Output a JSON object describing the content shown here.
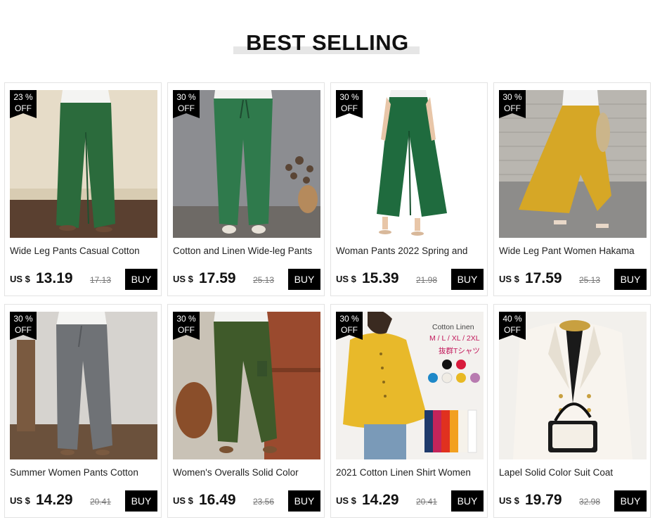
{
  "section": {
    "title": "BEST SELLING"
  },
  "products": [
    {
      "name": "Wide Leg Pants Casual Cotton",
      "discount_pct": "23 %",
      "discount_label": "OFF",
      "currency": "US $",
      "price": "13.19",
      "old_price": "17.13",
      "buy_label": "BUY",
      "image": "green-wide-leg-pants-photo"
    },
    {
      "name": "Cotton and Linen Wide-leg Pants",
      "discount_pct": "30 %",
      "discount_label": "OFF",
      "currency": "US $",
      "price": "17.59",
      "old_price": "25.13",
      "buy_label": "BUY",
      "image": "green-linen-pants-photo"
    },
    {
      "name": "Woman Pants 2022 Spring and",
      "discount_pct": "30 %",
      "discount_label": "OFF",
      "currency": "US $",
      "price": "15.39",
      "old_price": "21.98",
      "buy_label": "BUY",
      "image": "green-flare-pants-photo"
    },
    {
      "name": "Wide Leg Pant Women Hakama",
      "discount_pct": "30 %",
      "discount_label": "OFF",
      "currency": "US $",
      "price": "17.59",
      "old_price": "25.13",
      "buy_label": "BUY",
      "image": "mustard-hakama-pants-photo"
    },
    {
      "name": "Summer Women Pants Cotton",
      "discount_pct": "30 %",
      "discount_label": "OFF",
      "currency": "US $",
      "price": "14.29",
      "old_price": "20.41",
      "buy_label": "BUY",
      "image": "grey-wide-pants-photo"
    },
    {
      "name": "Women's Overalls Solid Color",
      "discount_pct": "30 %",
      "discount_label": "OFF",
      "currency": "US $",
      "price": "16.49",
      "old_price": "23.56",
      "buy_label": "BUY",
      "image": "army-green-cargo-pants-photo"
    },
    {
      "name": "2021 Cotton Linen Shirt Women",
      "discount_pct": "30 %",
      "discount_label": "OFF",
      "currency": "US $",
      "price": "14.29",
      "old_price": "20.41",
      "buy_label": "BUY",
      "image": "yellow-linen-shirt-photo",
      "ad_text": {
        "line1": "Cotton Linen",
        "line2": "M / L / XL / 2XL",
        "line3": "抜群Tシャツ"
      },
      "swatches": [
        "#111111",
        "#d81b3c",
        "#1e88c8",
        "#f0ece4",
        "#e8b923",
        "#b87bb0"
      ]
    },
    {
      "name": "Lapel Solid Color Suit Coat",
      "discount_pct": "40 %",
      "discount_label": "OFF",
      "currency": "US $",
      "price": "19.79",
      "old_price": "32.98",
      "buy_label": "BUY",
      "image": "white-blazer-photo"
    }
  ],
  "colors": {
    "buy_button": "#000000",
    "badge": "#000000",
    "header_underline": "#e6e6e6"
  }
}
